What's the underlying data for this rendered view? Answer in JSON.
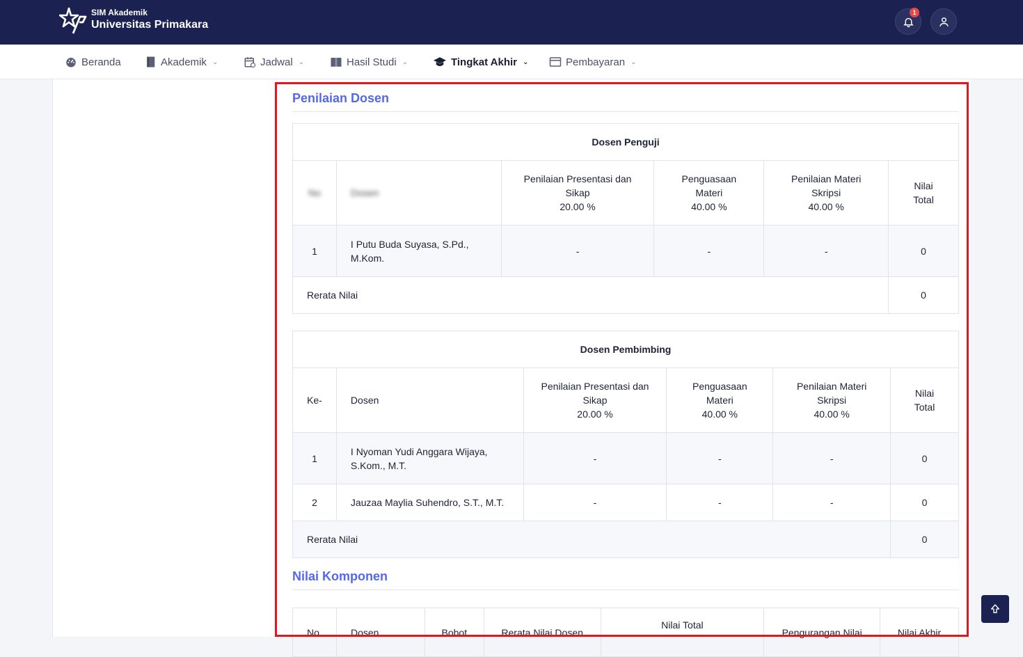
{
  "header": {
    "app_small": "SIM Akademik",
    "app_title": "Universitas Primakara",
    "notification_count": "1"
  },
  "nav": {
    "items": [
      {
        "label": "Beranda",
        "icon": "dashboard-icon"
      },
      {
        "label": "Akademik",
        "icon": "book-icon"
      },
      {
        "label": "Jadwal",
        "icon": "calendar-icon"
      },
      {
        "label": "Hasil Studi",
        "icon": "open-book-icon"
      },
      {
        "label": "Tingkat Akhir",
        "icon": "graduation-cap-icon"
      },
      {
        "label": "Pembayaran",
        "icon": "card-icon"
      }
    ]
  },
  "penilaian": {
    "title": "Penilaian Dosen",
    "penguji": {
      "group_title": "Dosen Penguji",
      "headers": {
        "no": "No",
        "dosen": "Dosen",
        "presentasi_1": "Penilaian Presentasi dan",
        "presentasi_2": "Sikap",
        "presentasi_pct": "20.00 %",
        "penguasaan_1": "Penguasaan",
        "penguasaan_2": "Materi",
        "penguasaan_pct": "40.00 %",
        "materi_1": "Penilaian Materi",
        "materi_2": "Skripsi",
        "materi_pct": "40.00 %",
        "total_1": "Nilai",
        "total_2": "Total"
      },
      "rows": [
        {
          "no": "1",
          "dosen_1": "I Putu Buda Suyasa, S.Pd.,",
          "dosen_2": "M.Kom.",
          "presentasi": "-",
          "penguasaan": "-",
          "materi": "-",
          "total": "0"
        }
      ],
      "rerata_label": "Rerata Nilai",
      "rerata_value": "0"
    },
    "pembimbing": {
      "group_title": "Dosen Pembimbing",
      "headers": {
        "no": "Ke-",
        "dosen": "Dosen",
        "presentasi_1": "Penilaian Presentasi dan",
        "presentasi_2": "Sikap",
        "presentasi_pct": "20.00 %",
        "penguasaan_1": "Penguasaan",
        "penguasaan_2": "Materi",
        "penguasaan_pct": "40.00 %",
        "materi_1": "Penilaian Materi",
        "materi_2": "Skripsi",
        "materi_pct": "40.00 %",
        "total_1": "Nilai",
        "total_2": "Total"
      },
      "rows": [
        {
          "no": "1",
          "dosen_1": "I Nyoman Yudi Anggara Wijaya,",
          "dosen_2": "S.Kom., M.T.",
          "presentasi": "-",
          "penguasaan": "-",
          "materi": "-",
          "total": "0"
        },
        {
          "no": "2",
          "dosen_1": "Jauzaa Maylia Suhendro, S.T., M.T.",
          "dosen_2": "",
          "presentasi": "-",
          "penguasaan": "-",
          "materi": "-",
          "total": "0"
        }
      ],
      "rerata_label": "Rerata Nilai",
      "rerata_value": "0"
    }
  },
  "komponen": {
    "title": "Nilai Komponen",
    "headers": {
      "no": "No",
      "dosen": "Dosen",
      "bobot": "Bobot",
      "rerata": "Rerata Nilai Dosen",
      "nilai_total": "Nilai Total",
      "pengurangan": "Pengurangan Nilai",
      "nilai_akhir": "Nilai Akhir"
    }
  }
}
